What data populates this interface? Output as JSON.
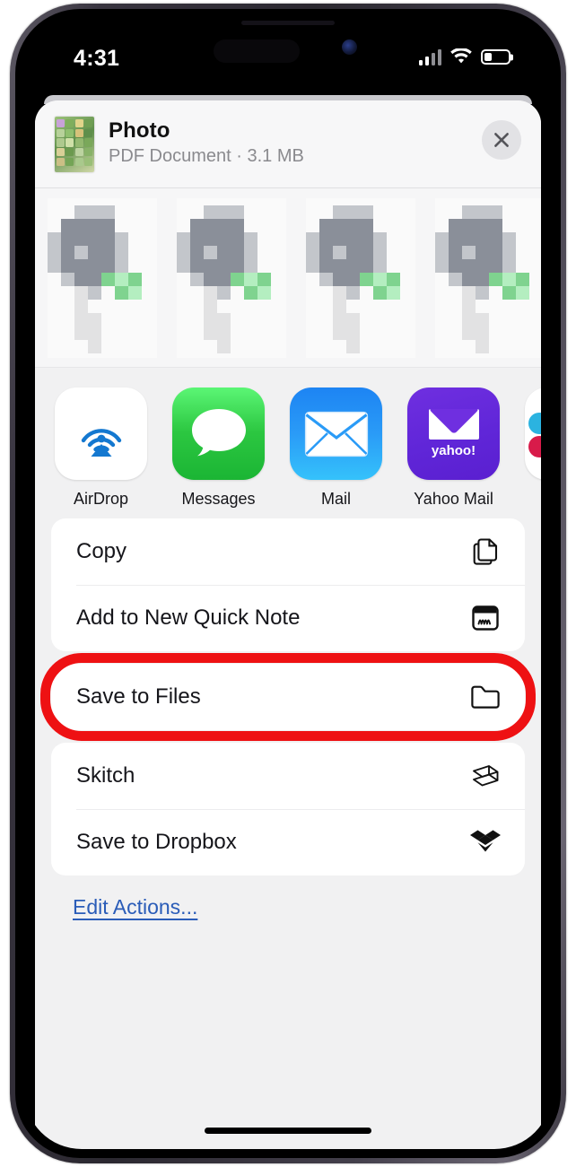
{
  "status_bar": {
    "time": "4:31",
    "signal_icon": "cellular-signal-icon",
    "wifi_icon": "wifi-icon",
    "battery_icon": "battery-low-icon",
    "battery_level_pct": 32
  },
  "share_sheet": {
    "header": {
      "thumbnail_name": "document-thumbnail",
      "title": "Photo",
      "subtitle": "PDF Document · 3.1 MB",
      "close_label": "Close",
      "close_icon": "close-x-icon"
    },
    "preview": {
      "name": "document-preview-strip",
      "pages_visible": 5,
      "state": "pixelated-redacted"
    },
    "apps": [
      {
        "label": "AirDrop",
        "icon": "airdrop-icon"
      },
      {
        "label": "Messages",
        "icon": "messages-icon"
      },
      {
        "label": "Mail",
        "icon": "mail-icon"
      },
      {
        "label": "Yahoo Mail",
        "icon": "yahoo-mail-icon",
        "wordmark": "yahoo!"
      },
      {
        "label": "",
        "icon": "more-apps-icon"
      }
    ],
    "action_groups": [
      {
        "rows": [
          {
            "label": "Copy",
            "icon": "copy-documents-icon"
          },
          {
            "label": "Add to New Quick Note",
            "icon": "quick-note-icon"
          }
        ]
      },
      {
        "highlighted": true,
        "highlight_color": "#ee1113",
        "rows": [
          {
            "label": "Save to Files",
            "icon": "folder-icon"
          }
        ]
      },
      {
        "rows": [
          {
            "label": "Skitch",
            "icon": "skitch-icon"
          },
          {
            "label": "Save to Dropbox",
            "icon": "dropbox-icon"
          }
        ]
      }
    ],
    "edit_actions_label": "Edit Actions..."
  },
  "device": {
    "home_indicator": "home-indicator",
    "buttons": [
      "mute-switch",
      "volume-up",
      "volume-down",
      "power-button"
    ]
  }
}
